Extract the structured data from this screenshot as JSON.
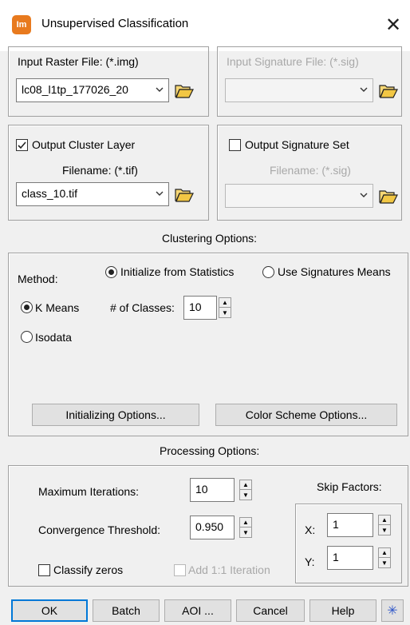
{
  "window": {
    "title": "Unsupervised Classification",
    "icon_text": "Im",
    "close_glyph": "✕"
  },
  "input_raster": {
    "label": "Input Raster File: (*.img)",
    "value": "lc08_l1tp_177026_20"
  },
  "input_signature": {
    "label": "Input Signature File: (*.sig)",
    "value": ""
  },
  "output_cluster": {
    "checkbox_label": "Output Cluster Layer",
    "checked": true,
    "filename_label": "Filename: (*.tif)",
    "value": "class_10.tif"
  },
  "output_signature": {
    "checkbox_label": "Output Signature Set",
    "checked": false,
    "filename_label": "Filename: (*.sig)",
    "value": ""
  },
  "clustering": {
    "header": "Clustering Options:",
    "method_label": "Method:",
    "init_stats_label": "Initialize from Statistics",
    "use_sig_label": "Use Signatures Means",
    "kmeans_label": "K Means",
    "isodata_label": "Isodata",
    "num_classes_label": "# of Classes:",
    "num_classes_value": "10",
    "init_options_button": "Initializing Options...",
    "color_scheme_button": "Color Scheme Options..."
  },
  "processing": {
    "header": "Processing Options:",
    "max_iter_label": "Maximum Iterations:",
    "max_iter_value": "10",
    "conv_label": "Convergence Threshold:",
    "conv_value": "0.950",
    "classify_zeros_label": "Classify zeros",
    "add_iter_label": "Add 1:1 Iteration",
    "skip_label": "Skip Factors:",
    "skip_x_label": "X:",
    "skip_x_value": "1",
    "skip_y_label": "Y:",
    "skip_y_value": "1"
  },
  "buttons": {
    "ok": "OK",
    "batch": "Batch",
    "aoi": "AOI ...",
    "cancel": "Cancel",
    "help": "Help",
    "star": "✳"
  },
  "colors": {
    "accent": "#0078d7",
    "disabled": "#a8a8a8",
    "icon_orange": "#e87a1e"
  }
}
